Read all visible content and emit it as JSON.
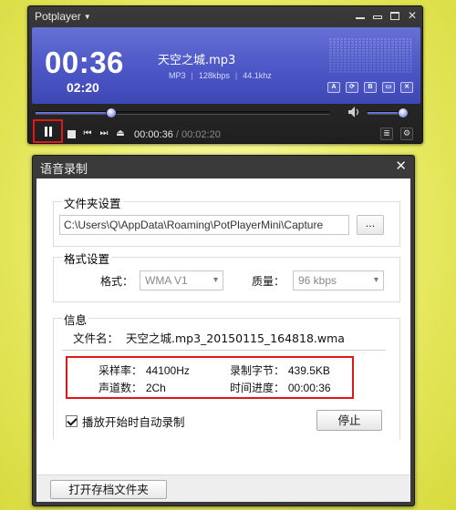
{
  "player": {
    "app_title": "Potplayer",
    "current_time_big": "00:36",
    "total_time_small": "02:20",
    "track_title": "天空之城.mp3",
    "meta": {
      "format": "MP3",
      "bitrate": "128kbps",
      "samplerate": "44.1khz",
      "separator": "|"
    },
    "mini_buttons": [
      "A",
      "⟳",
      "B",
      "▭",
      "✕"
    ],
    "seek_progress": 0.257,
    "volume_level": 0.88,
    "time_current": "00:00:36",
    "time_divider": " / ",
    "time_total": "00:02:20"
  },
  "dialog": {
    "title": "语音录制",
    "folder_group_label": "文件夹设置",
    "folder_path": "C:\\Users\\Q\\AppData\\Roaming\\PotPlayerMini\\Capture",
    "browse_label": "...",
    "format_group_label": "格式设置",
    "format_label": "格式：",
    "format_value": "WMA V1",
    "quality_label": "质量：",
    "quality_value": "96 kbps",
    "info_group_label": "信息",
    "filename_label": "文件名：",
    "filename_value": "天空之城.mp3_20150115_164818.wma",
    "stats": {
      "samplerate_label": "采样率：",
      "samplerate_value": "44100Hz",
      "bytes_label": "录制字节：",
      "bytes_value": "439.5KB",
      "channels_label": "声道数：",
      "channels_value": "2Ch",
      "progress_label": "时间进度：",
      "progress_value": "00:00:36"
    },
    "auto_record_label": "播放开始时自动录制",
    "auto_record_checked": true,
    "stop_button_label": "停止",
    "open_folder_button_label": "打开存档文件夹"
  },
  "colors": {
    "display_blue": "#4a54c4",
    "highlight_red": "#e01818",
    "window_dark": "#2a2a2a"
  }
}
